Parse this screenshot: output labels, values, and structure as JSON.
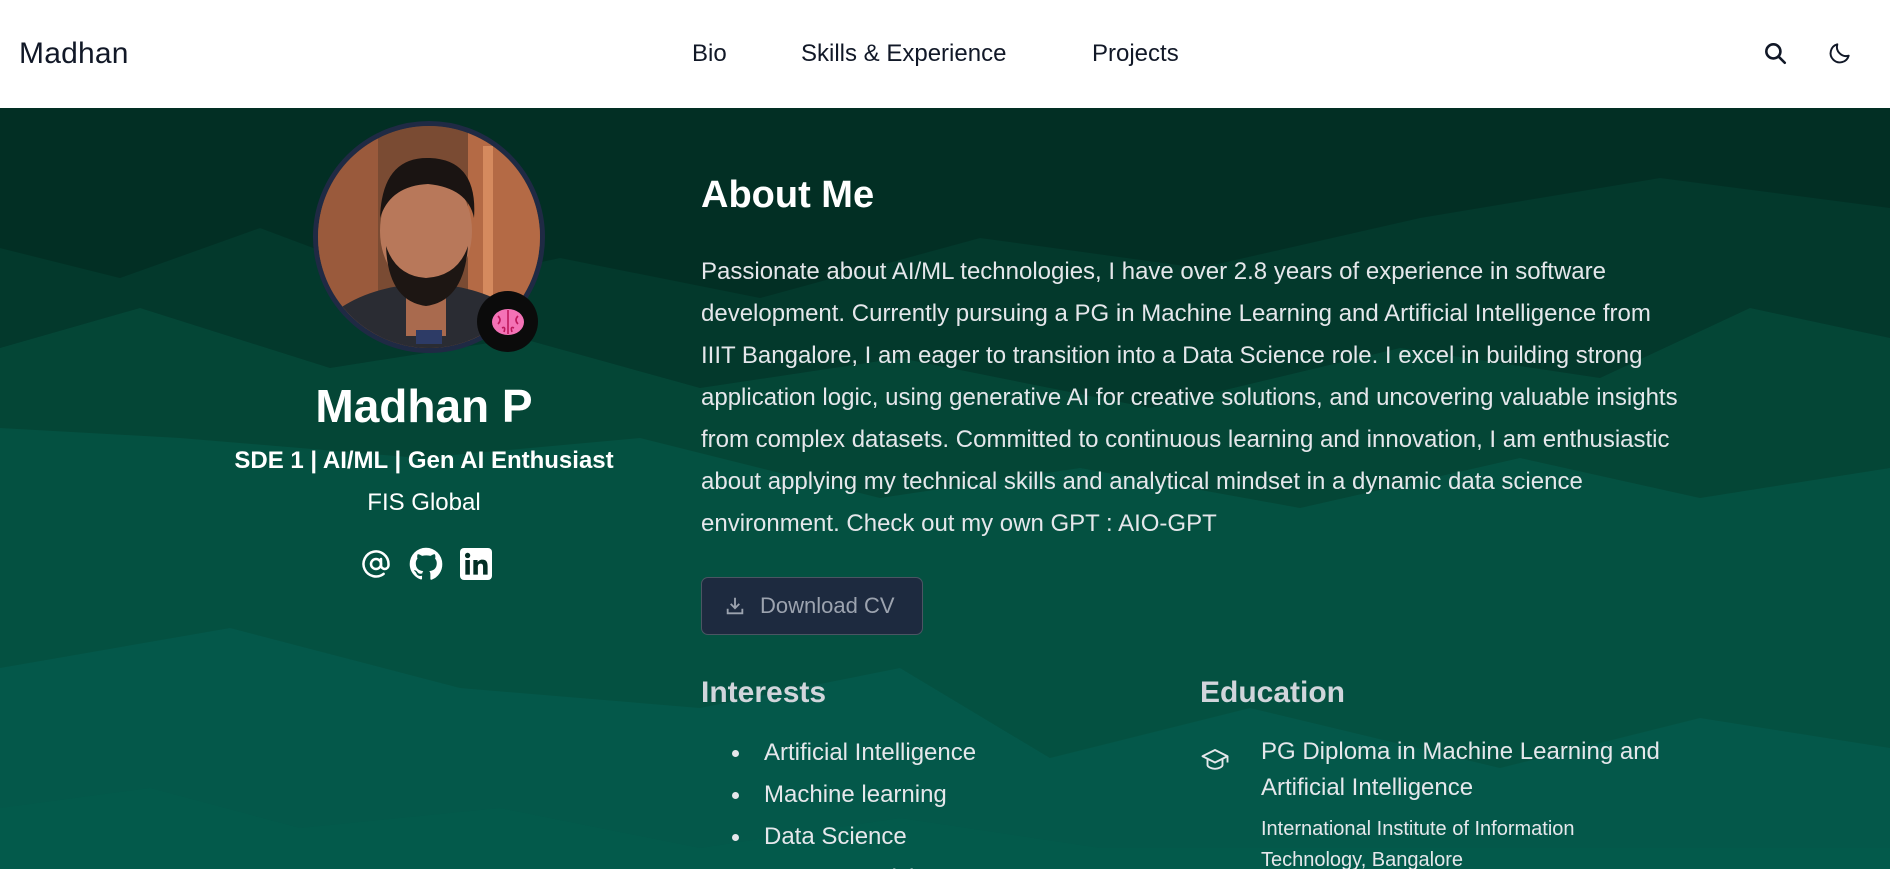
{
  "nav": {
    "brand": "Madhan",
    "links": [
      "Bio",
      "Skills & Experience",
      "Projects"
    ],
    "icons": [
      "search-icon",
      "moon-icon"
    ]
  },
  "profile": {
    "name": "Madhan P",
    "title": "SDE 1 | AI/ML | Gen AI Enthusiast",
    "company": "FIS Global",
    "badge_icon": "brain-icon",
    "socials": [
      "at-sign-icon",
      "github-icon",
      "linkedin-icon"
    ]
  },
  "about": {
    "heading": "About Me",
    "text": "Passionate about AI/ML technologies, I have over 2.8 years of experience in software development. Currently pursuing a PG in Machine Learning and Artificial Intelligence from IIIT Bangalore, I am eager to transition into a Data Science role. I excel in building strong application logic, using generative AI for creative solutions, and uncovering valuable insights from complex datasets. Committed to continuous learning and innovation, I am enthusiastic about applying my technical skills and analytical mindset in a dynamic data science environment. Check out my own GPT : AIO-GPT",
    "download_label": "Download CV"
  },
  "interests": {
    "heading": "Interests",
    "items": [
      "Artificial Intelligence",
      "Machine learning",
      "Data Science",
      "Computer Vision"
    ]
  },
  "education": {
    "heading": "Education",
    "items": [
      {
        "degree": "PG Diploma in Machine Learning and Artificial Intelligence",
        "school": "International Institute of Information Technology, Bangalore"
      }
    ]
  },
  "colors": {
    "hero_bg": "#032f25",
    "nav_bg": "#ffffff",
    "button_bg": "#1d2a3f",
    "brain": "#f472b6"
  }
}
